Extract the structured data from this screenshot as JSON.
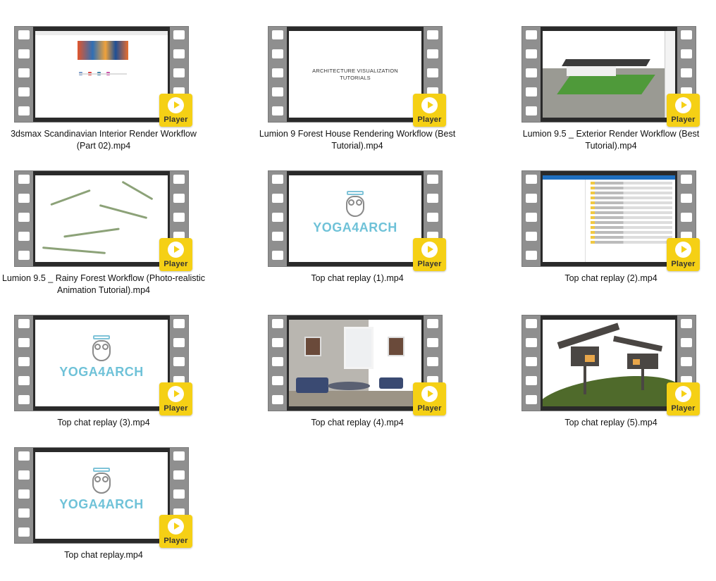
{
  "player_label": "Player",
  "items": [
    {
      "caption": "3dsmax Scandinavian Interior Render Workflow (Part 02).mp4",
      "thumb": "browser"
    },
    {
      "caption": "Lumion 9 Forest House Rendering Workflow (Best Tutorial).mp4",
      "thumb": "title",
      "thumb_text": "ARCHITECTURE VISUALIZATION\nTUTORIALS"
    },
    {
      "caption": "Lumion 9.5 _ Exterior Render Workflow (Best Tutorial).mp4",
      "thumb": "sketch"
    },
    {
      "caption": "Lumion 9.5 _ Rainy Forest Workflow (Photo-realistic Animation Tutorial).mp4",
      "thumb": "forest"
    },
    {
      "caption": "Top chat replay (1).mp4",
      "thumb": "yoga",
      "thumb_text": "YOGA4ARCH"
    },
    {
      "caption": "Top chat replay (2).mp4",
      "thumb": "explorer"
    },
    {
      "caption": "Top chat replay (3).mp4",
      "thumb": "yoga",
      "thumb_text": "YOGA4ARCH"
    },
    {
      "caption": "Top chat replay (4).mp4",
      "thumb": "room"
    },
    {
      "caption": "Top chat replay (5).mp4",
      "thumb": "house"
    },
    {
      "caption": "Top chat replay.mp4",
      "thumb": "yoga",
      "thumb_text": "YOGA4ARCH"
    }
  ]
}
